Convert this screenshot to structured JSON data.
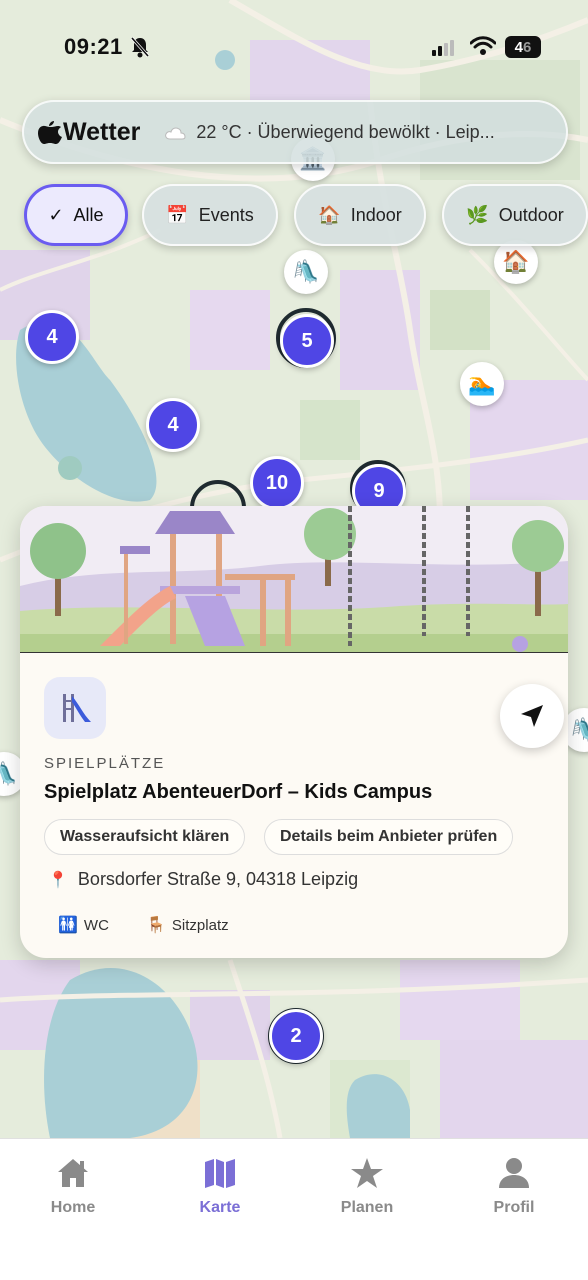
{
  "status_bar": {
    "time": "09:21",
    "battery_main": "4",
    "battery_dim": "6"
  },
  "weather": {
    "brand": "Wetter",
    "summary": "22 °C · Überwiegend bewölkt · Leip..."
  },
  "filters": [
    {
      "label": "Alle",
      "icon": "✓",
      "active": true
    },
    {
      "label": "Events",
      "icon": "calendar-icon",
      "active": false
    },
    {
      "label": "Indoor",
      "icon": "house-icon",
      "active": false
    },
    {
      "label": "Outdoor",
      "icon": "leaf-icon",
      "active": false
    }
  ],
  "map": {
    "clusters": [
      {
        "count": "4"
      },
      {
        "count": "5"
      },
      {
        "count": "4"
      },
      {
        "count": "10"
      },
      {
        "count": "9"
      },
      {
        "count": "2"
      }
    ],
    "pins": [
      "museum-icon",
      "slide-icon",
      "house-icon",
      "swimmer-icon"
    ]
  },
  "card": {
    "category": "SPIELPLÄTZE",
    "title": "Spielplatz AbenteuerDorf – Kids Campus",
    "tags": [
      "Wasseraufsicht klären",
      "Details beim Anbieter prüfen"
    ],
    "address": "Borsdorfer Straße 9, 04318 Leipzig",
    "amenities": [
      {
        "label": "WC",
        "icon": "restroom-icon"
      },
      {
        "label": "Sitzplatz",
        "icon": "chair-icon"
      }
    ]
  },
  "tab_bar": {
    "tabs": [
      {
        "label": "Home",
        "icon": "home-icon",
        "active": false
      },
      {
        "label": "Karte",
        "icon": "map-icon",
        "active": true
      },
      {
        "label": "Planen",
        "icon": "star-icon",
        "active": false
      },
      {
        "label": "Profil",
        "icon": "person-icon",
        "active": false
      }
    ]
  },
  "colors": {
    "accent": "#4f46e5",
    "active_tab": "#7b6fd6"
  }
}
